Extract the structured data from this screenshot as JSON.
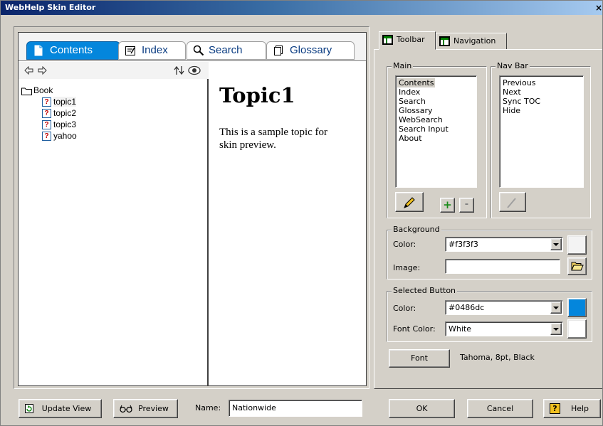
{
  "window": {
    "title": "WebHelp Skin Editor",
    "close_glyph": "×"
  },
  "preview": {
    "tabs": [
      {
        "label": "Contents",
        "icon": "page-icon",
        "active": true
      },
      {
        "label": "Index",
        "icon": "index-icon",
        "active": false
      },
      {
        "label": "Search",
        "icon": "search-icon",
        "active": false
      },
      {
        "label": "Glossary",
        "icon": "glossary-icon",
        "active": false
      }
    ],
    "tree": {
      "book": "Book",
      "topics": [
        "topic1",
        "topic2",
        "topic3",
        "yahoo"
      ],
      "selected": "topic1",
      "topic_glyph": "?"
    },
    "topic": {
      "heading": "Topic1",
      "body": "This is a sample topic for skin preview."
    }
  },
  "config": {
    "tabs": [
      {
        "label": "Toolbar",
        "active": true
      },
      {
        "label": "Navigation",
        "active": false
      }
    ],
    "main": {
      "legend": "Main",
      "items": [
        "Contents",
        "Index",
        "Search",
        "Glossary",
        "WebSearch",
        "Search Input",
        "About"
      ],
      "selected": "Contents",
      "add_glyph": "+",
      "remove_glyph": "-"
    },
    "navbar": {
      "legend": "Nav Bar",
      "items": [
        "Previous",
        "Next",
        "Sync TOC",
        "Hide"
      ]
    },
    "background": {
      "legend": "Background",
      "color_label": "Color:",
      "color_value": "#f3f3f3",
      "image_label": "Image:",
      "image_value": ""
    },
    "selected_button": {
      "legend": "Selected Button",
      "color_label": "Color:",
      "color_value": "#0486dc",
      "font_color_label": "Font Color:",
      "font_color_value": "White"
    },
    "font": {
      "button": "Font",
      "description": "Tahoma, 8pt, Black"
    }
  },
  "footer": {
    "update_view": "Update View",
    "preview": "Preview",
    "name_label": "Name:",
    "name_value": "Nationwide",
    "ok": "OK",
    "cancel": "Cancel",
    "help": "Help",
    "help_glyph": "?"
  },
  "colors": {
    "accent_blue": "#0486dc",
    "skin_bg": "#f3f3f3",
    "dialog_bg": "#d4d0c8",
    "title_start": "#0a246a",
    "title_end": "#a6caf0",
    "add_green": "#1a8c1a"
  }
}
